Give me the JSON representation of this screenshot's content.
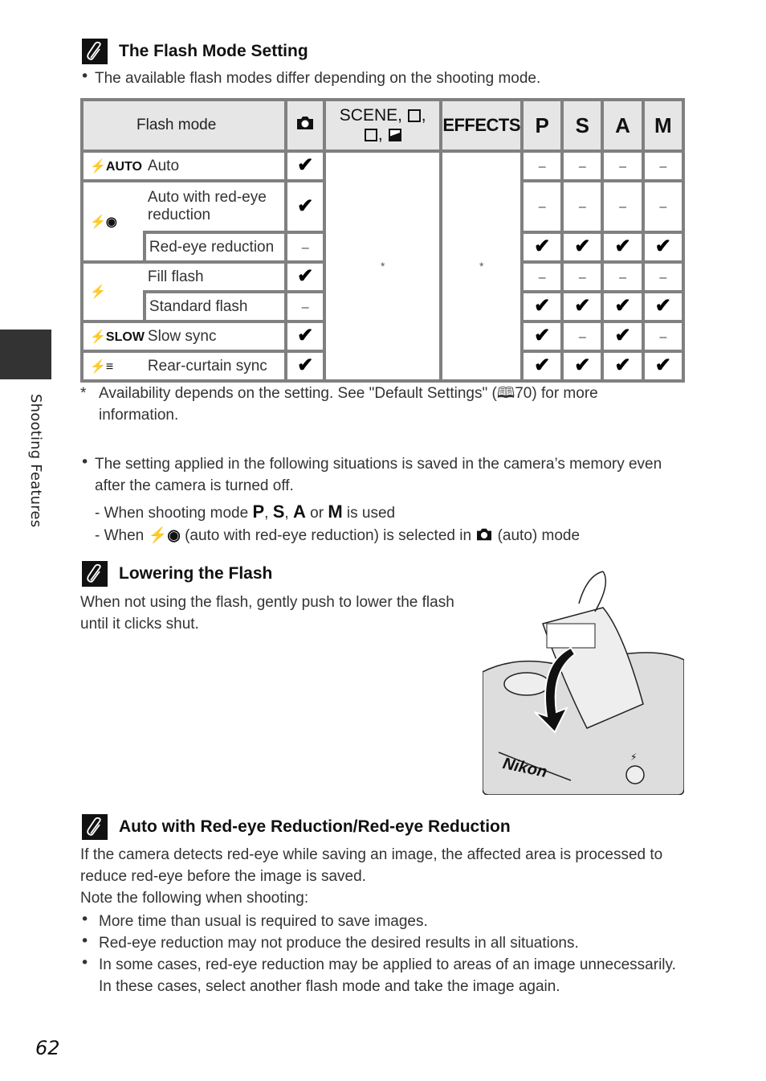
{
  "side_tab": {
    "label": "Shooting Features"
  },
  "page_number": "62",
  "section1": {
    "icon": "paperclip-note-icon",
    "title": "The Flash Mode Setting",
    "intro": "The available flash modes differ depending on the shooting mode."
  },
  "table": {
    "headers": {
      "flash_mode": "Flash mode",
      "auto_icon": "camera-auto-icon",
      "scene": "SCENE,",
      "effects": "EFFECTS",
      "p": "P",
      "s": "S",
      "a": "A",
      "m": "M"
    },
    "rows": [
      {
        "icon": "⚡AUTO",
        "icon_name": "flash-auto-icon",
        "label": "Auto",
        "auto": "check",
        "p": "–",
        "s": "–",
        "a": "–",
        "m": "–"
      },
      {
        "icon": "⚡◉",
        "icon_name": "flash-red-eye-icon",
        "label": "Auto with red-eye reduction",
        "auto": "check",
        "p": "–",
        "s": "–",
        "a": "–",
        "m": "–"
      },
      {
        "icon": "",
        "label": "Red-eye reduction",
        "auto": "–",
        "p": "check",
        "s": "check",
        "a": "check",
        "m": "check"
      },
      {
        "icon": "⚡",
        "icon_name": "flash-fill-icon",
        "label": "Fill flash",
        "auto": "check",
        "p": "–",
        "s": "–",
        "a": "–",
        "m": "–"
      },
      {
        "icon": "",
        "label": "Standard flash",
        "auto": "–",
        "p": "check",
        "s": "check",
        "a": "check",
        "m": "check"
      },
      {
        "icon": "⚡SLOW",
        "icon_name": "flash-slow-sync-icon",
        "label": "Slow sync",
        "auto": "check",
        "p": "check",
        "s": "–",
        "a": "check",
        "m": "–"
      },
      {
        "icon": "⚡≡",
        "icon_name": "flash-rear-curtain-icon",
        "label": "Rear-curtain sync",
        "auto": "check",
        "p": "check",
        "s": "check",
        "a": "check",
        "m": "check"
      }
    ],
    "scene_value": "*",
    "effects_value": "*",
    "check_glyph": "✔",
    "footnote_mark": "*",
    "footnote": "Availability depends on the setting. See \"Default Settings\" (🕮70) for more information."
  },
  "memory_note": {
    "bullet": "The setting applied in the following situations is saved in the camera’s memory even after the camera is turned off.",
    "sub1_prefix": "- When shooting mode",
    "sub1_p": "P",
    "sub1_s": "S",
    "sub1_a": "A",
    "sub1_or": "or",
    "sub1_m": "M",
    "sub1_suffix": "is used",
    "sub2_prefix": "- When",
    "sub2_middle": "(auto with red-eye reduction) is selected in",
    "sub2_suffix": "(auto) mode"
  },
  "section2": {
    "title": "Lowering the Flash",
    "body": "When not using the flash, gently push to lower the flash until it clicks shut.",
    "illustration_label": "Nikon"
  },
  "section3": {
    "title": "Auto with Red-eye Reduction/Red-eye Reduction",
    "para1": "If the camera detects red-eye while saving an image, the affected area is processed to reduce red-eye before the image is saved.",
    "para2": "Note the following when shooting:",
    "bullets": [
      "More time than usual is required to save images.",
      "Red-eye reduction may not produce the desired results in all situations.",
      "In some cases, red-eye reduction may be applied to areas of an image unnecessarily. In these cases, select another flash mode and take the image again."
    ]
  }
}
